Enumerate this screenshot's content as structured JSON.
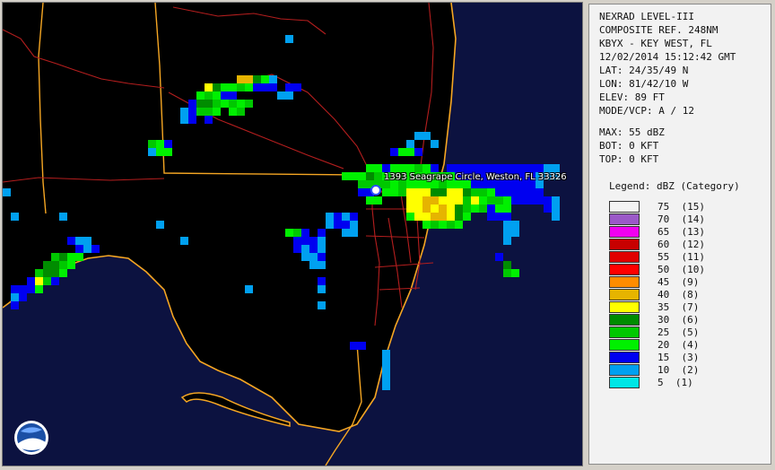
{
  "header": {
    "product": "NEXRAD LEVEL-III",
    "type": "COMPOSITE REF. 248NM",
    "station": "KBYX - KEY WEST, FL",
    "datetime": "12/02/2014 15:12:42 GMT",
    "lat": "LAT: 24/35/49 N",
    "lon": "LON: 81/42/10 W",
    "elev": "ELEV: 89 FT",
    "mode": "MODE/VCP: A / 12"
  },
  "stats": {
    "max": "MAX: 55 dBZ",
    "bot": "BOT: 0 KFT",
    "top": "TOP: 0 KFT"
  },
  "legend": {
    "title": "Legend: dBZ (Category)",
    "items": [
      {
        "label": "75  (15)",
        "color": "#f4f4f4"
      },
      {
        "label": "70  (14)",
        "color": "#9b59c8"
      },
      {
        "label": "65  (13)",
        "color": "#f000f0"
      },
      {
        "label": "60  (12)",
        "color": "#c80000"
      },
      {
        "label": "55  (11)",
        "color": "#e00000"
      },
      {
        "label": "50  (10)",
        "color": "#ff0000"
      },
      {
        "label": "45  (9)",
        "color": "#ff8c00"
      },
      {
        "label": "40  (8)",
        "color": "#e6b400"
      },
      {
        "label": "35  (7)",
        "color": "#ffff00"
      },
      {
        "label": "30  (6)",
        "color": "#008c00"
      },
      {
        "label": "25  (5)",
        "color": "#00c800"
      },
      {
        "label": "20  (4)",
        "color": "#00f000"
      },
      {
        "label": "15  (3)",
        "color": "#0000f0"
      },
      {
        "label": "10  (2)",
        "color": "#00a0f0"
      },
      {
        "label": "5  (1)",
        "color": "#00e6e6"
      }
    ]
  },
  "map": {
    "location_label": "1393 Seagrape Circle, Weston, FL 33326",
    "logo": "NOAA",
    "colors": {
      "ocean": "#0c1240",
      "land": "#000000",
      "coast": "#f5a623",
      "roads": "#b41e1e"
    }
  }
}
